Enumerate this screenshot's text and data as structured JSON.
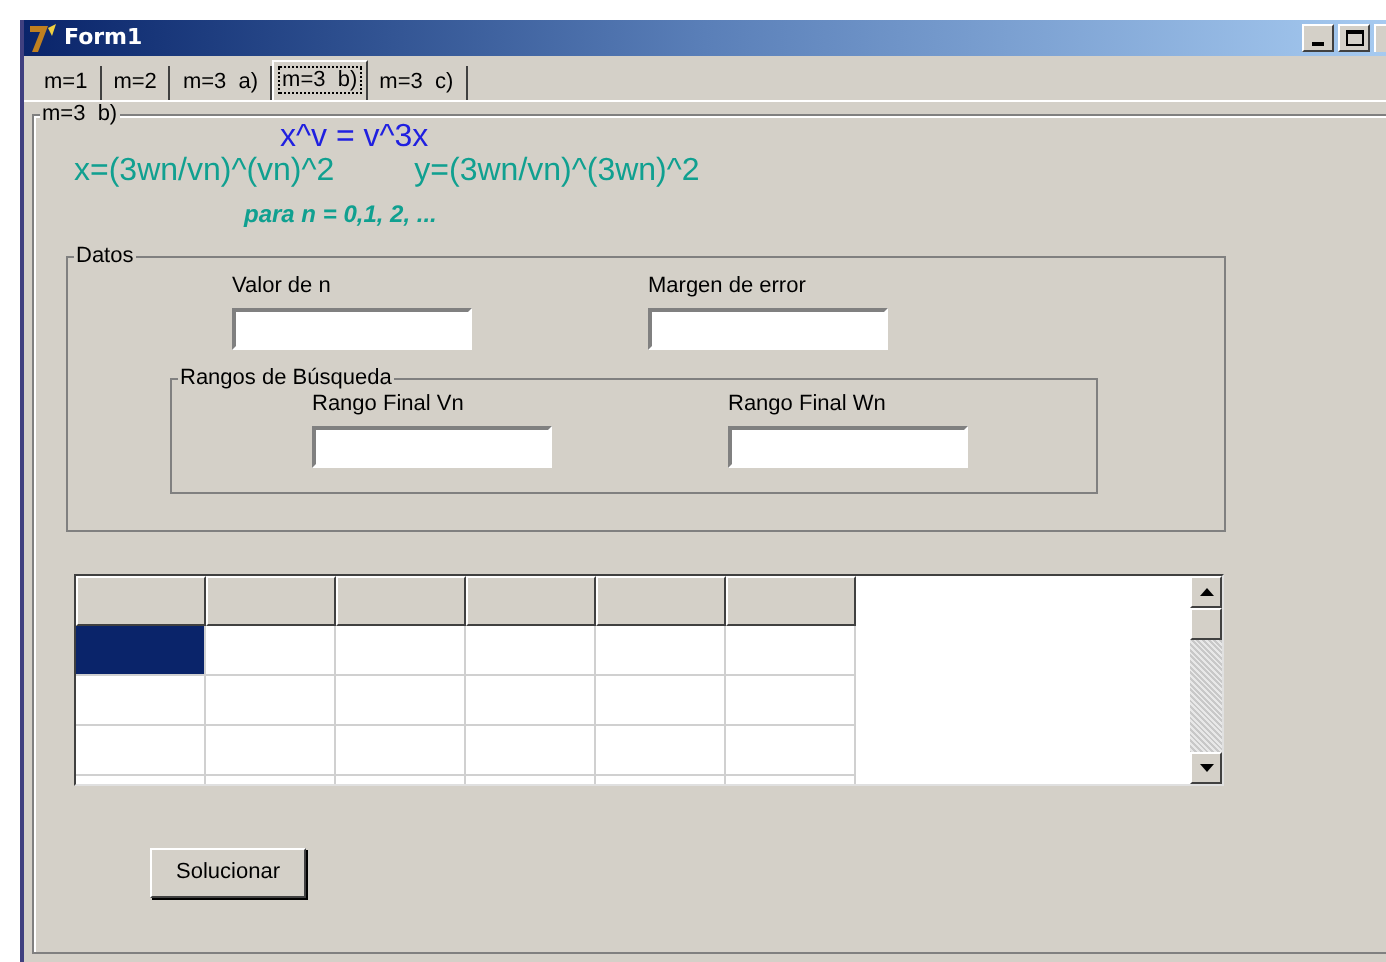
{
  "window": {
    "title": "Form1"
  },
  "tabs": [
    {
      "label": "m=1",
      "selected": false
    },
    {
      "label": "m=2",
      "selected": false
    },
    {
      "label": "m=3  a)",
      "selected": false
    },
    {
      "label": "m=3  b)",
      "selected": true
    },
    {
      "label": "m=3  c)",
      "selected": false
    }
  ],
  "page": {
    "title": "m=3  b)",
    "equation": "x^v = v^3x",
    "solution_x": "x=(3wn/vn)^(vn)^2",
    "solution_y": "y=(3wn/vn)^(3wn)^2",
    "condition": "para n = 0,1, 2, ..."
  },
  "datos": {
    "title": "Datos",
    "fields": [
      {
        "label": "Valor de n"
      },
      {
        "label": "Margen de error"
      }
    ],
    "rangos": {
      "title": "Rangos de Búsqueda",
      "fields": [
        {
          "label": "Rango Final Vn"
        },
        {
          "label": "Rango Final Wn"
        }
      ]
    }
  },
  "grid": {
    "rows": [
      {
        "cells": [
          {
            "selected": true
          },
          {
            "selected": false
          },
          {
            "selected": false
          },
          {
            "selected": false
          },
          {
            "selected": false
          },
          {
            "selected": false
          }
        ]
      },
      {
        "cells": [
          {
            "selected": false
          },
          {
            "selected": false
          },
          {
            "selected": false
          },
          {
            "selected": false
          },
          {
            "selected": false
          },
          {
            "selected": false
          }
        ]
      },
      {
        "cells": [
          {
            "selected": false
          },
          {
            "selected": false
          },
          {
            "selected": false
          },
          {
            "selected": false
          },
          {
            "selected": false
          },
          {
            "selected": false
          }
        ]
      },
      {
        "cells": [
          {
            "selected": false
          },
          {
            "selected": false
          },
          {
            "selected": false
          },
          {
            "selected": false
          },
          {
            "selected": false
          },
          {
            "selected": false
          }
        ]
      }
    ]
  },
  "buttons": [
    "Solucionar"
  ]
}
